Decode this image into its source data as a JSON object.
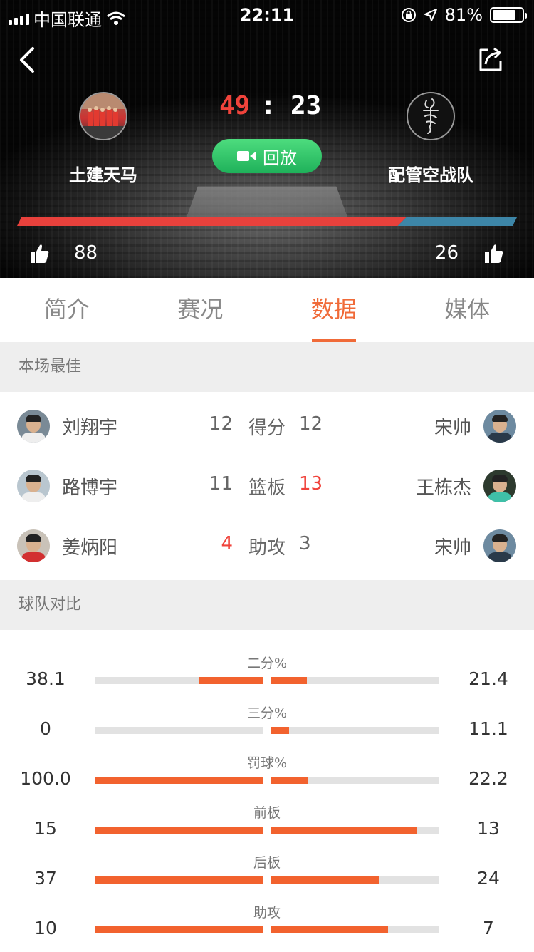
{
  "status_bar": {
    "carrier": "中国联通",
    "time": "22:11",
    "battery": "81%",
    "battery_level": 0.81
  },
  "match": {
    "home": {
      "name": "土建天马",
      "score": "49",
      "likes": "88"
    },
    "away": {
      "name": "配管空战队",
      "score": "23",
      "likes": "26"
    },
    "colon": ":",
    "replay_label": "回放",
    "home_share": 0.77,
    "colors": {
      "home": "#e8413c",
      "away": "#3d86a8",
      "replay": "#2fc46a"
    }
  },
  "tabs": [
    {
      "label": "简介",
      "active": false
    },
    {
      "label": "赛况",
      "active": false
    },
    {
      "label": "数据",
      "active": true
    },
    {
      "label": "媒体",
      "active": false
    }
  ],
  "best": {
    "header": "本场最佳",
    "rows": [
      {
        "left_name": "刘翔宇",
        "left_value": "12",
        "category": "得分",
        "right_value": "12",
        "right_name": "宋帅",
        "hot": ""
      },
      {
        "left_name": "路博宇",
        "left_value": "11",
        "category": "篮板",
        "right_value": "13",
        "right_name": "王栋杰",
        "hot": "right"
      },
      {
        "left_name": "姜炳阳",
        "left_value": "4",
        "category": "助攻",
        "right_value": "3",
        "right_name": "宋帅",
        "hot": "left"
      }
    ]
  },
  "compare": {
    "header": "球队对比",
    "rows": [
      {
        "label": "二分%",
        "left": "38.1",
        "right": "21.4",
        "left_fill": 0.381,
        "right_fill": 0.214
      },
      {
        "label": "三分%",
        "left": "0",
        "right": "11.1",
        "left_fill": 0.0,
        "right_fill": 0.111
      },
      {
        "label": "罚球%",
        "left": "100.0",
        "right": "22.2",
        "left_fill": 1.0,
        "right_fill": 0.222
      },
      {
        "label": "前板",
        "left": "15",
        "right": "13",
        "left_fill": 1.0,
        "right_fill": 0.87
      },
      {
        "label": "后板",
        "left": "37",
        "right": "24",
        "left_fill": 1.0,
        "right_fill": 0.65
      },
      {
        "label": "助攻",
        "left": "10",
        "right": "7",
        "left_fill": 1.0,
        "right_fill": 0.7
      }
    ]
  }
}
